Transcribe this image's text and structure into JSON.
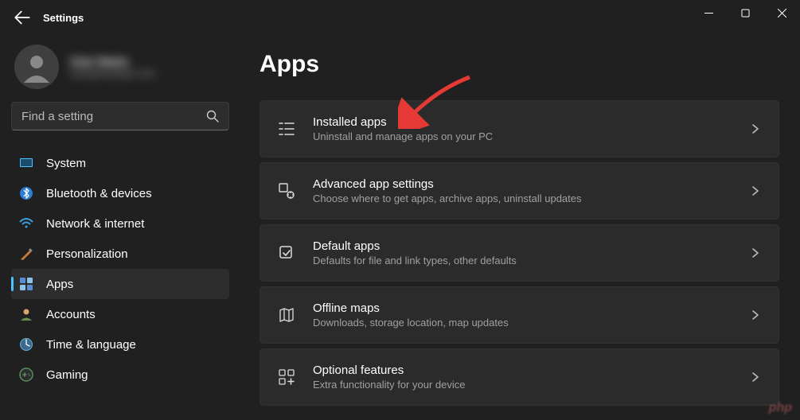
{
  "window": {
    "title": "Settings"
  },
  "user": {
    "name": "User Name",
    "email": "user@example.com"
  },
  "search": {
    "placeholder": "Find a setting"
  },
  "sidebar": {
    "items": [
      {
        "label": "System"
      },
      {
        "label": "Bluetooth & devices"
      },
      {
        "label": "Network & internet"
      },
      {
        "label": "Personalization"
      },
      {
        "label": "Apps"
      },
      {
        "label": "Accounts"
      },
      {
        "label": "Time & language"
      },
      {
        "label": "Gaming"
      }
    ],
    "active_index": 4
  },
  "main": {
    "title": "Apps",
    "cards": [
      {
        "title": "Installed apps",
        "desc": "Uninstall and manage apps on your PC"
      },
      {
        "title": "Advanced app settings",
        "desc": "Choose where to get apps, archive apps, uninstall updates"
      },
      {
        "title": "Default apps",
        "desc": "Defaults for file and link types, other defaults"
      },
      {
        "title": "Offline maps",
        "desc": "Downloads, storage location, map updates"
      },
      {
        "title": "Optional features",
        "desc": "Extra functionality for your device"
      }
    ]
  },
  "watermark": "php"
}
